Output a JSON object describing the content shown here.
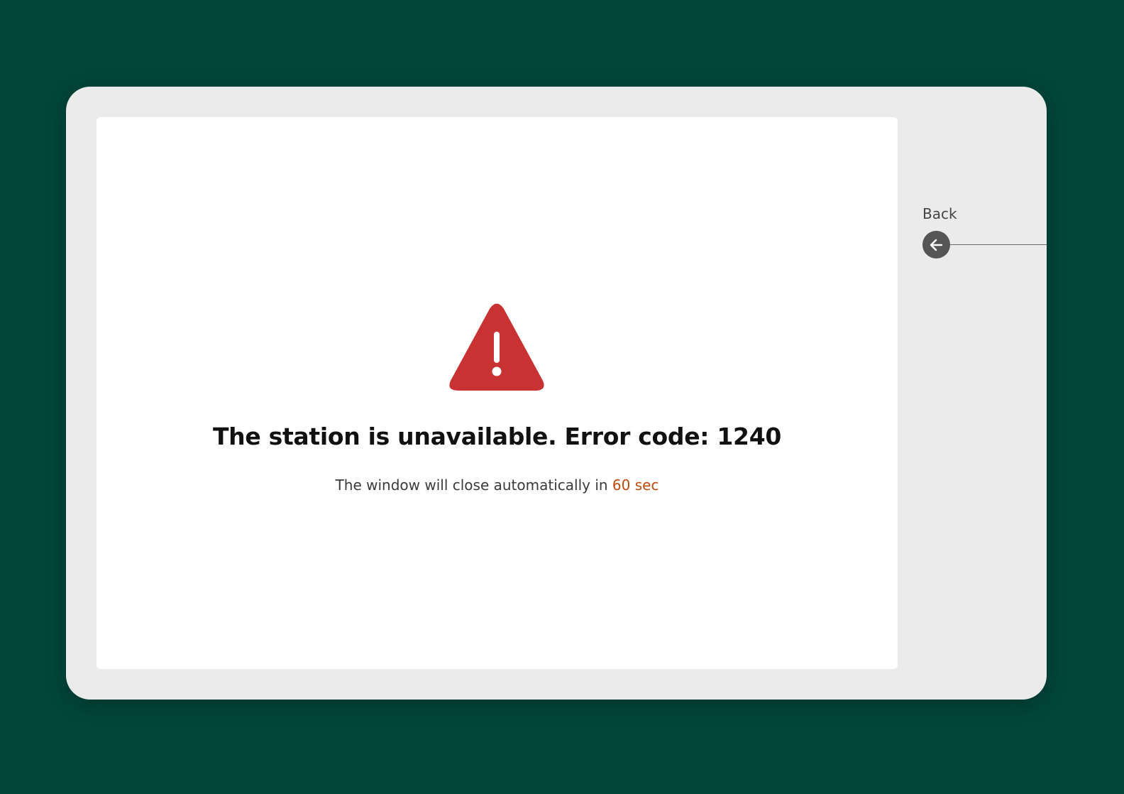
{
  "colors": {
    "background": "#02463a",
    "warning_red": "#c83232",
    "countdown_accent": "#c04a10"
  },
  "dialog": {
    "icon": "warning-triangle-icon",
    "title": "The station is unavailable. Error code: 1240",
    "countdown_text": "The window will close automatically in",
    "countdown_value": "60 sec"
  },
  "side_nav": {
    "back_label": "Back",
    "back_icon": "arrow-left-icon"
  }
}
